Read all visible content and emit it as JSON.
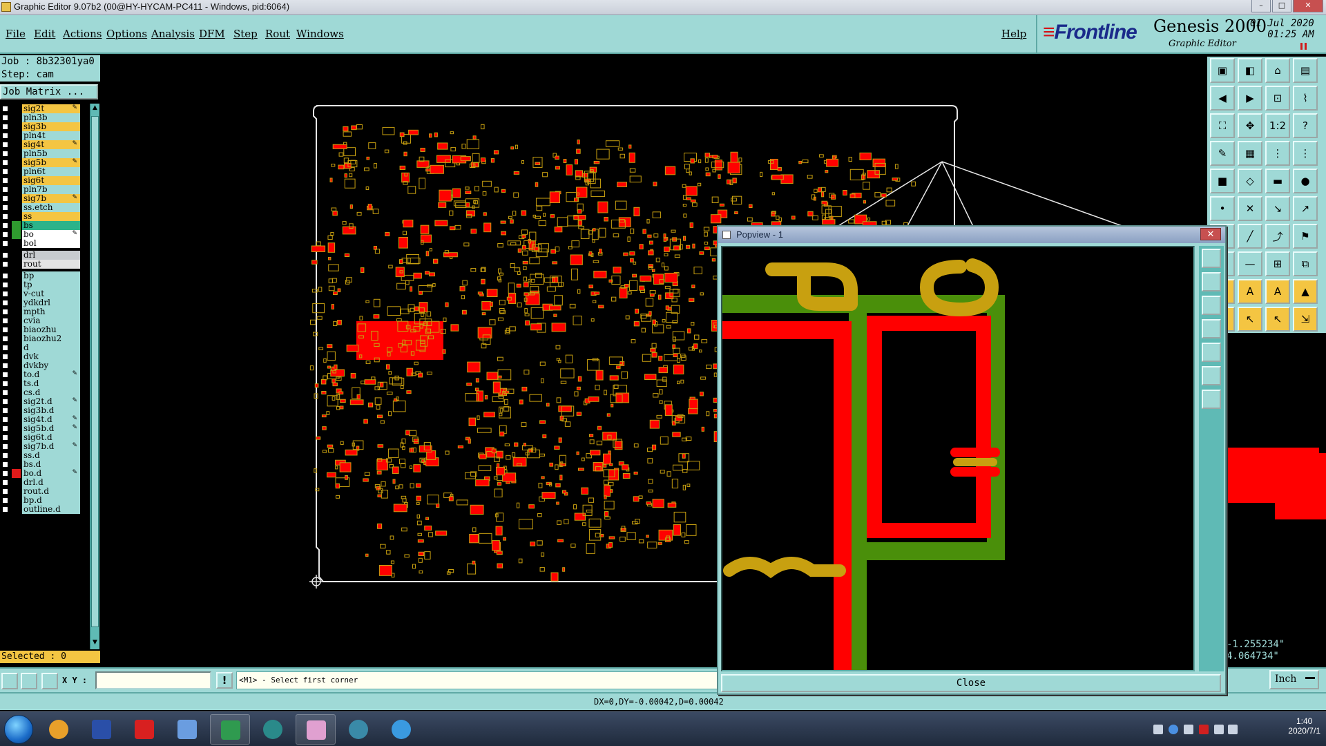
{
  "window": {
    "title": "Graphic Editor 9.07b2 (00@HY-HYCAM-PC411 - Windows, pid:6064)"
  },
  "menu": {
    "items": [
      "File",
      "Edit",
      "Actions",
      "Options",
      "Analysis",
      "DFM",
      "Step",
      "Rout",
      "Windows"
    ],
    "help": "Help"
  },
  "brand": {
    "logo": "Frontline",
    "product": "Genesis 2000",
    "subtitle": "Graphic Editor",
    "date": "01 Jul 2020",
    "time": "01:25 AM"
  },
  "job": {
    "job_line": "Job : 8b32301ya0",
    "step_line": "Step: cam",
    "matrix_button": "Job Matrix ..."
  },
  "layers": [
    {
      "name": "sig2t",
      "color": "#f4c542",
      "edit": true,
      "swatch": ""
    },
    {
      "name": "pln3b",
      "color": "#9fd9d6",
      "edit": false,
      "swatch": ""
    },
    {
      "name": "sig3b",
      "color": "#f4c542",
      "edit": false,
      "swatch": ""
    },
    {
      "name": "pln4t",
      "color": "#9fd9d6",
      "edit": false,
      "swatch": ""
    },
    {
      "name": "sig4t",
      "color": "#f4c542",
      "edit": true,
      "swatch": ""
    },
    {
      "name": "pln5b",
      "color": "#9fd9d6",
      "edit": false,
      "swatch": ""
    },
    {
      "name": "sig5b",
      "color": "#f4c542",
      "edit": true,
      "swatch": ""
    },
    {
      "name": "pln6t",
      "color": "#9fd9d6",
      "edit": false,
      "swatch": ""
    },
    {
      "name": "sig6t",
      "color": "#f4c542",
      "edit": false,
      "swatch": ""
    },
    {
      "name": "pln7b",
      "color": "#9fd9d6",
      "edit": false,
      "swatch": ""
    },
    {
      "name": "sig7b",
      "color": "#f4c542",
      "edit": true,
      "swatch": ""
    },
    {
      "name": "ss.etch",
      "color": "#9fd9d6",
      "edit": false,
      "swatch": ""
    },
    {
      "name": "ss",
      "color": "#f4c542",
      "edit": false,
      "swatch": ""
    },
    {
      "name": "bs",
      "color": "#2bb38a",
      "edit": false,
      "swatch": "#2f9a2f"
    },
    {
      "name": "bo",
      "color": "#ffffff",
      "edit": true,
      "swatch": "#2f9a2f"
    },
    {
      "name": "bol",
      "color": "#ffffff",
      "edit": false,
      "swatch": ""
    },
    {
      "name": "drl",
      "color": "#c7cbcf",
      "edit": false,
      "swatch": ""
    },
    {
      "name": "rout",
      "color": "#e3e3e3",
      "edit": false,
      "swatch": ""
    },
    {
      "name": "bp",
      "color": "#9fd9d6",
      "edit": false,
      "swatch": ""
    },
    {
      "name": "tp",
      "color": "#9fd9d6",
      "edit": false,
      "swatch": ""
    },
    {
      "name": "v-cut",
      "color": "#9fd9d6",
      "edit": false,
      "swatch": ""
    },
    {
      "name": "ydkdrl",
      "color": "#9fd9d6",
      "edit": false,
      "swatch": ""
    },
    {
      "name": "mpth",
      "color": "#9fd9d6",
      "edit": false,
      "swatch": ""
    },
    {
      "name": "cvia",
      "color": "#9fd9d6",
      "edit": false,
      "swatch": ""
    },
    {
      "name": "biaozhu",
      "color": "#9fd9d6",
      "edit": false,
      "swatch": ""
    },
    {
      "name": "biaozhu2",
      "color": "#9fd9d6",
      "edit": false,
      "swatch": ""
    },
    {
      "name": "d",
      "color": "#9fd9d6",
      "edit": false,
      "swatch": ""
    },
    {
      "name": "dvk",
      "color": "#9fd9d6",
      "edit": false,
      "swatch": ""
    },
    {
      "name": "dvkby",
      "color": "#9fd9d6",
      "edit": false,
      "swatch": ""
    },
    {
      "name": "to.d",
      "color": "#9fd9d6",
      "edit": true,
      "swatch": ""
    },
    {
      "name": "ts.d",
      "color": "#9fd9d6",
      "edit": false,
      "swatch": ""
    },
    {
      "name": "cs.d",
      "color": "#9fd9d6",
      "edit": false,
      "swatch": ""
    },
    {
      "name": "sig2t.d",
      "color": "#9fd9d6",
      "edit": true,
      "swatch": ""
    },
    {
      "name": "sig3b.d",
      "color": "#9fd9d6",
      "edit": false,
      "swatch": ""
    },
    {
      "name": "sig4t.d",
      "color": "#9fd9d6",
      "edit": true,
      "swatch": ""
    },
    {
      "name": "sig5b.d",
      "color": "#9fd9d6",
      "edit": true,
      "swatch": ""
    },
    {
      "name": "sig6t.d",
      "color": "#9fd9d6",
      "edit": false,
      "swatch": ""
    },
    {
      "name": "sig7b.d",
      "color": "#9fd9d6",
      "edit": true,
      "swatch": ""
    },
    {
      "name": "ss.d",
      "color": "#9fd9d6",
      "edit": false,
      "swatch": ""
    },
    {
      "name": "bs.d",
      "color": "#9fd9d6",
      "edit": false,
      "swatch": ""
    },
    {
      "name": "bo.d",
      "color": "#9fd9d6",
      "edit": true,
      "swatch": "#e01a1a"
    },
    {
      "name": "drl.d",
      "color": "#9fd9d6",
      "edit": false,
      "swatch": ""
    },
    {
      "name": "rout.d",
      "color": "#9fd9d6",
      "edit": false,
      "swatch": ""
    },
    {
      "name": "bp.d",
      "color": "#9fd9d6",
      "edit": false,
      "swatch": ""
    },
    {
      "name": "outline.d",
      "color": "#9fd9d6",
      "edit": false,
      "swatch": ""
    }
  ],
  "selected_text": "Selected : 0",
  "status": {
    "xy_label": "X Y :",
    "xy_value": "",
    "prompt": "<M1> - Select first corner",
    "delta": "DX=0,DY=-0.00042,D=0.00042",
    "coord_x": "-1.255234\"",
    "coord_y": "4.064734\"",
    "units": "Inch"
  },
  "popview": {
    "title": "Popview - 1",
    "close_label": "Close",
    "close_x": "✕"
  },
  "taskbar": {
    "time": "1:40",
    "date": "2020/7/1"
  },
  "colors": {
    "teal": "#9fd9d6",
    "red": "#ff0000",
    "gold": "#c8a010",
    "green": "#4a8f0a"
  }
}
